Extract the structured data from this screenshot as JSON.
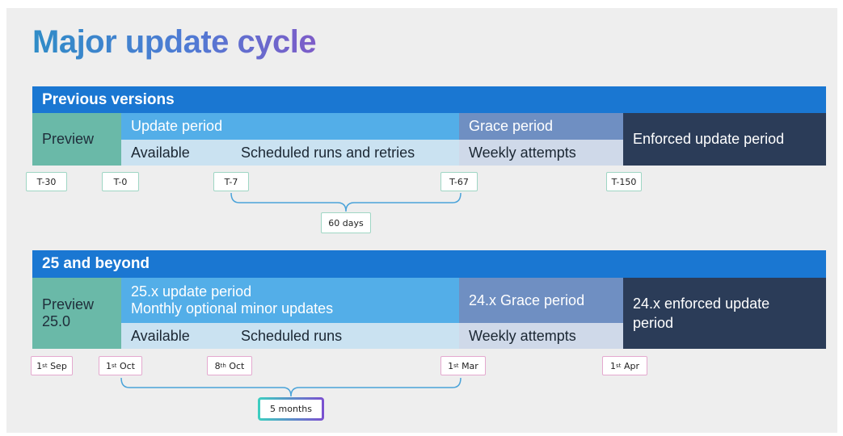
{
  "title": "Major update cycle",
  "previous": {
    "header": "Previous versions",
    "preview": "Preview",
    "update_period": "Update period",
    "available": "Available",
    "scheduled": "Scheduled runs and retries",
    "grace": "Grace period",
    "weekly": "Weekly attempts",
    "enforced": "Enforced update period",
    "markers": [
      "T-30",
      "T-0",
      "T-7",
      "T-67",
      "T-150"
    ],
    "duration": "60 days"
  },
  "future": {
    "header": "25 and beyond",
    "preview_line1": "Preview",
    "preview_line2": "25.0",
    "update_line1": "25.x update period",
    "update_line2": "Monthly optional minor updates",
    "available": "Available",
    "scheduled": "Scheduled runs",
    "grace": "24.x Grace period",
    "weekly": "Weekly attempts",
    "enforced_line1": "24.x enforced update",
    "enforced_line2": "period",
    "markers": [
      {
        "day": "1",
        "suffix": "st",
        "month": "Sep"
      },
      {
        "day": "1",
        "suffix": "st",
        "month": "Oct"
      },
      {
        "day": "8",
        "suffix": "th",
        "month": "Oct"
      },
      {
        "day": "1",
        "suffix": "st",
        "month": "Mar"
      },
      {
        "day": "1",
        "suffix": "st",
        "month": "Apr"
      }
    ],
    "duration": "5 months"
  },
  "colors": {
    "header": "#1a77d2",
    "preview": "#6ab9a8",
    "update": "#53aee8",
    "available": "#cae2f1",
    "grace": "#6f8fc2",
    "weekly": "#cfd9e9",
    "enforced": "#2b3c58"
  }
}
